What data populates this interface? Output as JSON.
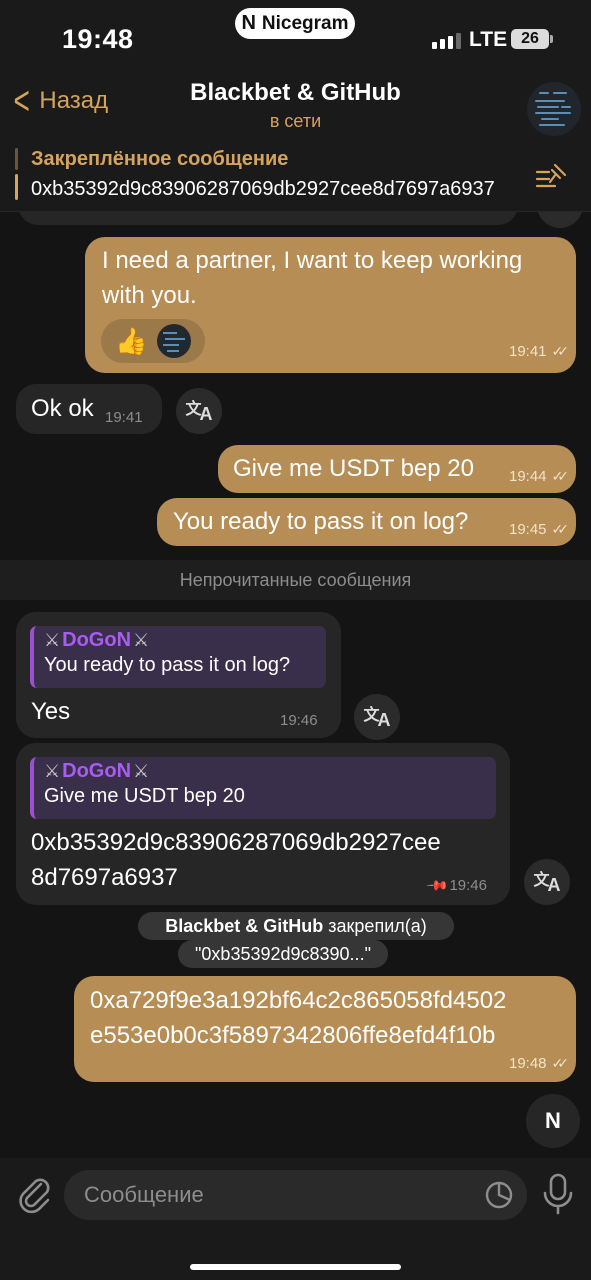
{
  "status_bar": {
    "time": "19:48",
    "app_badge": "Nicegram",
    "network": "LTE",
    "battery": "26"
  },
  "header": {
    "back_label": "Назад",
    "title": "Blackbet & GitHub",
    "status": "в сети"
  },
  "pinned": {
    "title": "Закреплённое сообщение",
    "text": "0xb35392d9c83906287069db2927cee8d7697a6937"
  },
  "messages": [
    {
      "direction": "out",
      "text": "I need a partner, I want to keep working with you.",
      "time": "19:41",
      "reactions": [
        "👍"
      ]
    },
    {
      "direction": "in",
      "text": "Ok ok",
      "time": "19:41"
    },
    {
      "direction": "out",
      "text": "Give me USDT bep 20",
      "time": "19:44"
    },
    {
      "direction": "out",
      "text": "You ready to pass it on log?",
      "time": "19:45"
    },
    {
      "direction": "in",
      "reply_to": {
        "sender": "DoGoN",
        "text": "You ready to pass it on log?"
      },
      "text": "Yes",
      "time": "19:46"
    },
    {
      "direction": "in",
      "reply_to": {
        "sender": "DoGoN",
        "text": "Give me USDT bep 20"
      },
      "text_line1": "0xb35392d9c83906287069db2927cee",
      "text_line2": "8d7697a6937",
      "time": "19:46",
      "pinned": true
    },
    {
      "direction": "out",
      "text_line1": "0xa729f9e3a192bf64c2c865058fd4502",
      "text_line2": "e553e0b0c3f5897342806ffe8efd4f10b",
      "time": "19:48"
    }
  ],
  "unread_divider": "Непрочитанные сообщения",
  "service_message": {
    "actor": "Blackbet & GitHub",
    "action": "закрепил(а)",
    "quote": "\"0xb35392d9c8390...\""
  },
  "input": {
    "placeholder": "Сообщение"
  },
  "colors": {
    "accent": "#d5a35c",
    "outgoing_bubble": "#b58d55",
    "incoming_bubble": "#262626",
    "reply_name": "#a85cf0"
  },
  "icons": [
    "back-chevron-icon",
    "pinned-list-icon",
    "translate-icon",
    "pin-icon",
    "attach-icon",
    "sticker-icon",
    "microphone-icon",
    "nicegram-icon",
    "crossed-swords-icon"
  ]
}
